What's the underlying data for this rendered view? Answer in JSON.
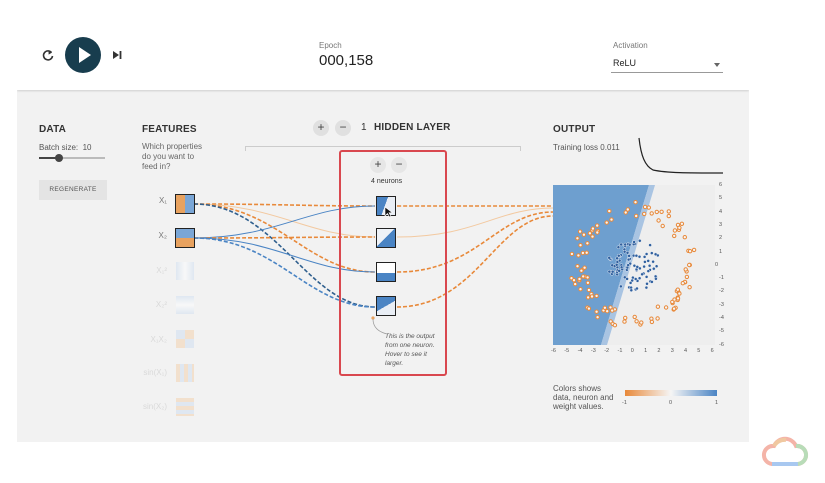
{
  "toolbar": {
    "epoch_label": "Epoch",
    "epoch_value": "000,158",
    "activation_label": "Activation",
    "activation_value": "ReLU"
  },
  "data_panel": {
    "title": "DATA",
    "batch_size_label": "Batch size:",
    "batch_size_value": "10",
    "batch_size_fraction": 0.3,
    "regenerate_label": "REGENERATE"
  },
  "features_panel": {
    "title": "FEATURES",
    "subtitle_lines": [
      "Which properties",
      "do you want to",
      "feed in?"
    ],
    "features": [
      {
        "label": "X₁",
        "active": true
      },
      {
        "label": "X₂",
        "active": true
      },
      {
        "label": "X₁²",
        "active": false
      },
      {
        "label": "X₂²",
        "active": false
      },
      {
        "label": "X₁X₂",
        "active": false
      },
      {
        "label": "sin(X₁)",
        "active": false
      },
      {
        "label": "sin(X₂)",
        "active": false
      }
    ]
  },
  "hidden": {
    "count": "1",
    "title": "HIDDEN LAYER",
    "plus": "+",
    "minus": "−",
    "neurons_label": "4 neurons",
    "note_lines": [
      "This is the output",
      "from one neuron.",
      "Hover to see it",
      "larger."
    ]
  },
  "output": {
    "title": "OUTPUT",
    "training_loss": "Training loss 0.011",
    "y_ticks": [
      "6",
      "5",
      "4",
      "3",
      "2",
      "1",
      "0",
      "-1",
      "-2",
      "-3",
      "-4",
      "-5",
      "-6"
    ],
    "x_ticks": [
      "-6",
      "-5",
      "-4",
      "-3",
      "-2",
      "-1",
      "0",
      "1",
      "2",
      "3",
      "4",
      "5",
      "6"
    ],
    "legend_lines": [
      "Colors shows",
      "data, neuron and",
      "weight values."
    ],
    "scale_ticks": [
      "-1",
      "0",
      "1"
    ],
    "colors": {
      "blue": "#4a84c4",
      "orange": "#e8893a",
      "frame": "#d9484f"
    }
  }
}
